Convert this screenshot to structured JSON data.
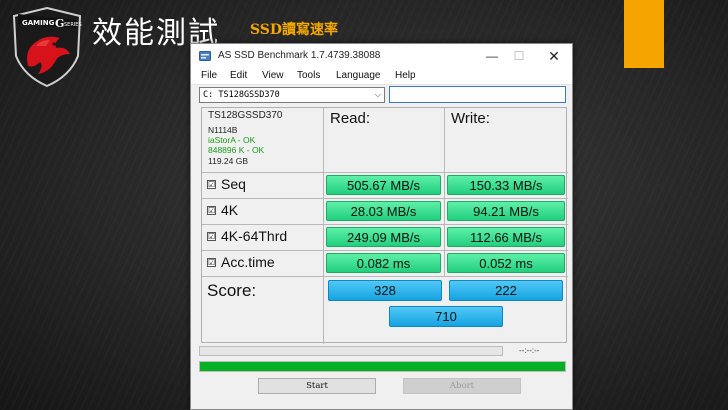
{
  "slide": {
    "title": "效能測試",
    "subtitle": "SSD讀寫速率",
    "logo_icon": "msi-gaming-series-dragon-shield"
  },
  "window": {
    "title": "AS SSD Benchmark 1.7.4739.38088",
    "controls": {
      "minimize": "—",
      "maximize": "☐",
      "close": "✕"
    },
    "menu": [
      "File",
      "Edit",
      "View",
      "Tools",
      "Language",
      "Help"
    ],
    "drive_select": {
      "value": "C: TS128GSSD370",
      "arrow": "⌵"
    },
    "extra_field": {
      "value": ""
    }
  },
  "drive_info": {
    "name": "TS128GSSD370",
    "firmware": "N1114B",
    "driver_status": "iaStorA - OK",
    "alignment_status": "848896 K - OK",
    "size": "119.24 GB"
  },
  "columns": {
    "read": "Read:",
    "write": "Write:"
  },
  "tests": [
    {
      "label": "Seq",
      "checked": "☑",
      "read": "505.67 MB/s",
      "write": "150.33 MB/s"
    },
    {
      "label": "4K",
      "checked": "☑",
      "read": "28.03 MB/s",
      "write": "94.21 MB/s"
    },
    {
      "label": "4K-64Thrd",
      "checked": "☑",
      "read": "249.09 MB/s",
      "write": "112.66 MB/s"
    },
    {
      "label": "Acc.time",
      "checked": "☑",
      "read": "0.082 ms",
      "write": "0.052 ms"
    }
  ],
  "score": {
    "label": "Score:",
    "read": "328",
    "write": "222",
    "total": "710"
  },
  "progress": {
    "time_text": "--:--:--",
    "overall_fraction": 1.0
  },
  "buttons": {
    "start": "Start",
    "abort": "Abort"
  },
  "colors": {
    "accent_orange": "#f5a400",
    "result_green": "#21cf7d",
    "score_blue": "#15a3e3",
    "progress_green": "#06b025",
    "ok_green": "#1c9a1c"
  }
}
